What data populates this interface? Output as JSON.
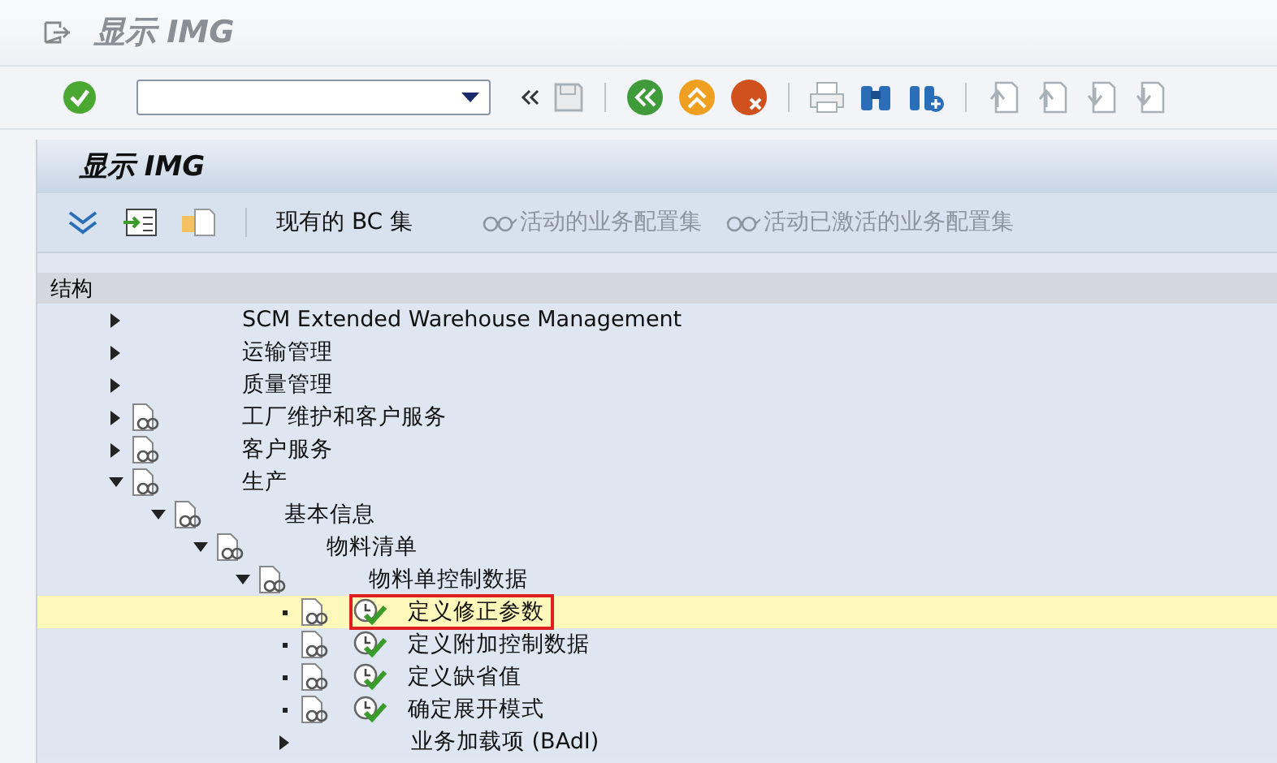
{
  "window": {
    "title": "显示 IMG"
  },
  "panel": {
    "title": "显示 IMG",
    "actions": [
      {
        "label": "现有的 BC 集",
        "kind": "text",
        "disabled": false
      },
      {
        "label": "活动的业务配置集",
        "kind": "glasses",
        "disabled": true
      },
      {
        "label": "活动已激活的业务配置集",
        "kind": "glasses",
        "disabled": true
      }
    ]
  },
  "tree": {
    "header": "结构",
    "items": [
      {
        "label": "SCM Extended Warehouse Management",
        "kind": "plain",
        "expanded": false,
        "selected": false
      },
      {
        "label": "运输管理",
        "kind": "plain",
        "expanded": false,
        "selected": false
      },
      {
        "label": "质量管理",
        "kind": "plain",
        "expanded": false,
        "selected": false
      },
      {
        "label": "工厂维护和客户服务",
        "kind": "doc",
        "expanded": false,
        "selected": false
      },
      {
        "label": "客户服务",
        "kind": "doc",
        "expanded": false,
        "selected": false
      },
      {
        "label": "生产",
        "kind": "doc",
        "expanded": true,
        "selected": false,
        "children": [
          {
            "label": "基本信息",
            "kind": "doc",
            "expanded": true,
            "selected": false,
            "children": [
              {
                "label": "物料清单",
                "kind": "doc",
                "expanded": true,
                "selected": false,
                "children": [
                  {
                    "label": "物料单控制数据",
                    "kind": "doc",
                    "expanded": true,
                    "selected": false,
                    "children": [
                      {
                        "label": "定义修正参数",
                        "kind": "activity",
                        "selected": true
                      },
                      {
                        "label": "定义附加控制数据",
                        "kind": "activity",
                        "selected": false
                      },
                      {
                        "label": "定义缺省值",
                        "kind": "activity",
                        "selected": false
                      },
                      {
                        "label": "确定展开模式",
                        "kind": "activity",
                        "selected": false
                      },
                      {
                        "label": "业务加载项 (BAdI)",
                        "kind": "plain",
                        "expanded": false,
                        "selected": false
                      }
                    ]
                  }
                ]
              }
            ]
          }
        ]
      }
    ]
  }
}
